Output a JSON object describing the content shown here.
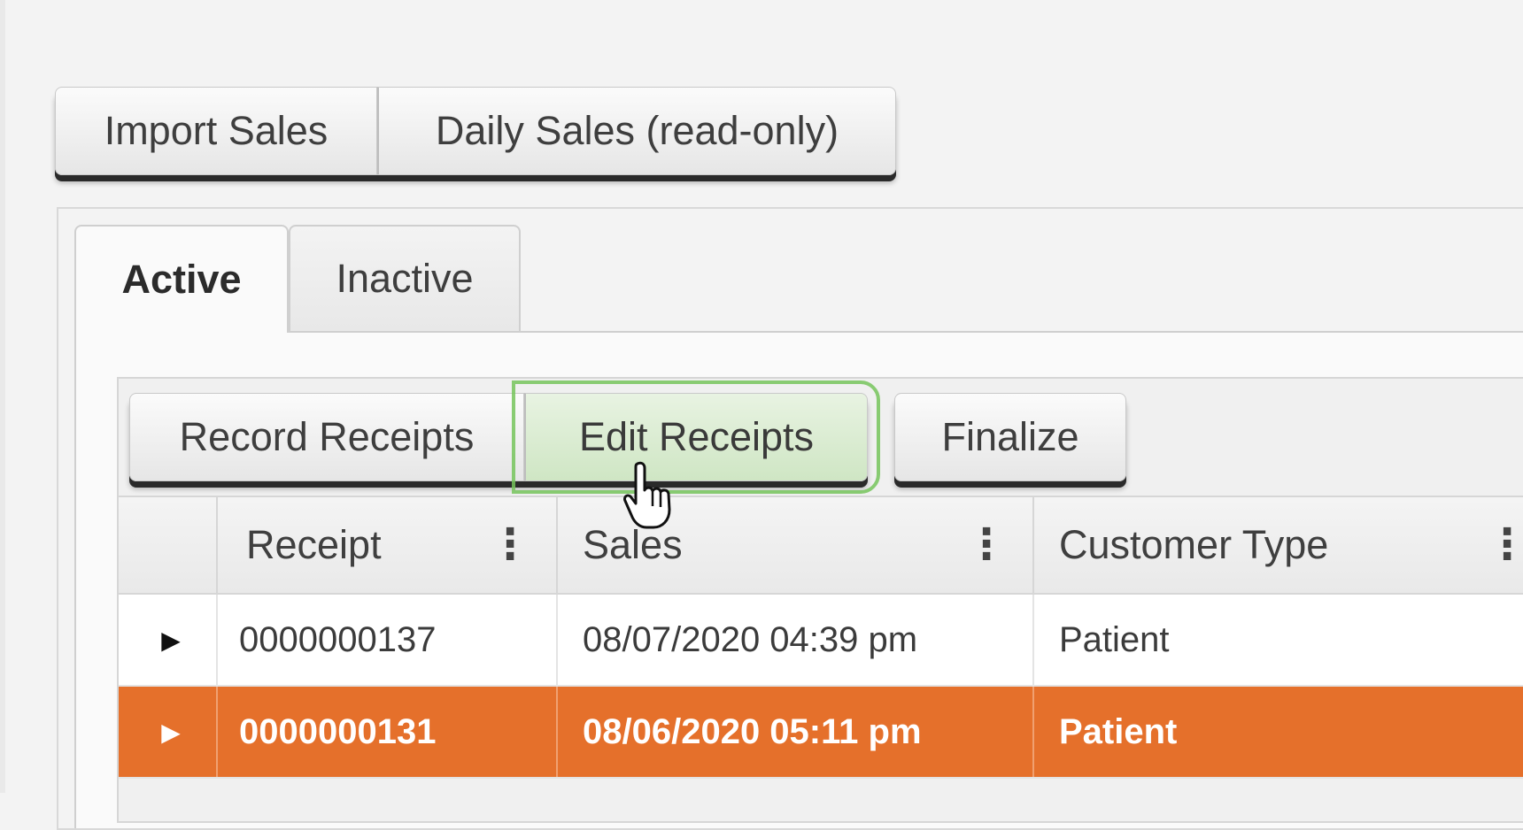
{
  "toolbar_top": {
    "import_label": "Import Sales",
    "daily_label": "Daily Sales (read-only)"
  },
  "tabs": [
    {
      "label": "Active",
      "selected": true
    },
    {
      "label": "Inactive",
      "selected": false
    }
  ],
  "grid_toolbar": {
    "record_label": "Record Receipts",
    "edit_label": "Edit Receipts",
    "finalize_label": "Finalize"
  },
  "table": {
    "columns": [
      "Receipt",
      "Sales",
      "Customer Type"
    ],
    "rows": [
      {
        "receipt": "0000000137",
        "sales": "08/07/2020 04:39 pm",
        "customer_type": "Patient",
        "selected": false
      },
      {
        "receipt": "0000000131",
        "sales": "08/06/2020 05:11 pm",
        "customer_type": "Patient",
        "selected": true
      }
    ]
  },
  "colors": {
    "selected_row": "#e5702b",
    "edit_highlight": "#76c45c"
  },
  "icons": {
    "expand": "triangle-right-icon",
    "column_menu": "kebab-icon",
    "cursor": "hand-pointer-icon"
  }
}
